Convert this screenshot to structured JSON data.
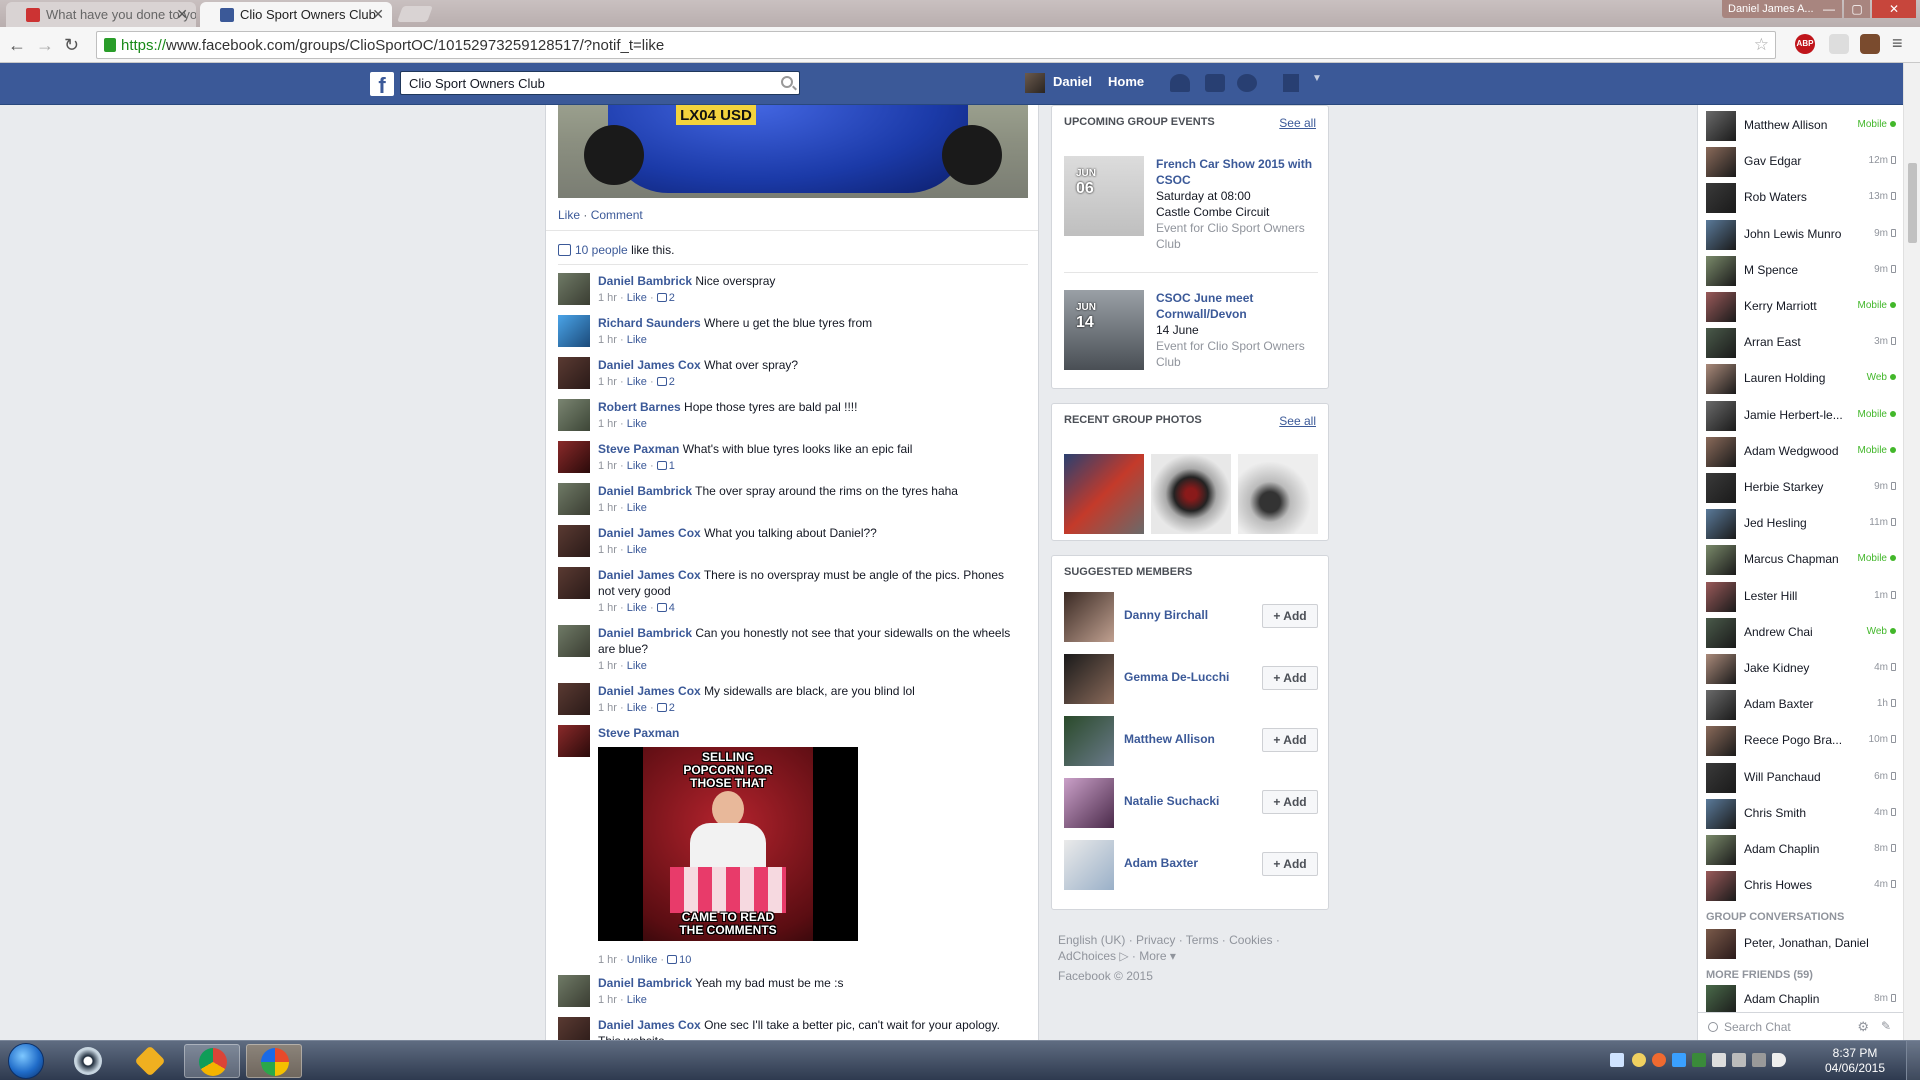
{
  "browser": {
    "tabs": [
      {
        "title": "What have you done to yo"
      },
      {
        "title": "Clio Sport Owners Club"
      }
    ],
    "window_user": "Daniel James A...",
    "url_https": "https://",
    "url_rest": "www.facebook.com/groups/ClioSportOC/10152973259128517/?notif_t=like",
    "extension_badge": "ABP"
  },
  "fb_header": {
    "logo": "f",
    "search_value": "Clio Sport Owners Club",
    "user_name": "Daniel",
    "home_label": "Home"
  },
  "post": {
    "plate": "LX04 USD",
    "like_label": "Like",
    "comment_label": "Comment",
    "likes_people": "10 people",
    "likes_suffix": "like this."
  },
  "comments": [
    {
      "name": "Daniel Bambrick",
      "text": "Nice overspray",
      "time": "1 hr",
      "likes": "2"
    },
    {
      "name": "Richard Saunders",
      "text": "Where u get the blue tyres from",
      "time": "1 hr",
      "likes": ""
    },
    {
      "name": "Daniel James Cox",
      "text": "What over spray?",
      "time": "1 hr",
      "likes": "2"
    },
    {
      "name": "Robert Barnes",
      "text": "Hope those tyres are bald pal !!!!",
      "time": "1 hr",
      "likes": ""
    },
    {
      "name": "Steve Paxman",
      "text": "What's with blue tyres looks like an epic fail",
      "time": "1 hr",
      "likes": "1"
    },
    {
      "name": "Daniel Bambrick",
      "text": "The over spray around the rims on the tyres haha",
      "time": "1 hr",
      "likes": ""
    },
    {
      "name": "Daniel James Cox",
      "text": "What you talking about Daniel??",
      "time": "1 hr",
      "likes": ""
    },
    {
      "name": "Daniel James Cox",
      "text": "There is no overspray must be angle of the pics. Phones not very good",
      "time": "1 hr",
      "likes": "4"
    },
    {
      "name": "Daniel Bambrick",
      "text": "Can you honestly not see that your sidewalls on the wheels are blue?",
      "time": "1 hr",
      "likes": ""
    },
    {
      "name": "Daniel James Cox",
      "text": "My sidewalls are black, are you blind lol",
      "time": "1 hr",
      "likes": "2"
    },
    {
      "name": "Steve Paxman",
      "text": "",
      "time": "1 hr",
      "likes": "10"
    },
    {
      "name": "Daniel Bambrick",
      "text": "Yeah my bad must be me :s",
      "time": "1 hr",
      "likes": ""
    },
    {
      "name": "Daniel James Cox",
      "text": "One sec I'll take a better pic, can't wait for your apology. This website",
      "time": "",
      "likes": ""
    }
  ],
  "comment_meta": {
    "like": "Like",
    "unlike": "Unlike",
    "sep": " · "
  },
  "meme": {
    "top_text": "SELLING POPCORN FOR THOSE THAT",
    "bottom_text": "CAME TO READ THE COMMENTS"
  },
  "events_panel": {
    "title": "UPCOMING GROUP EVENTS",
    "see_all": "See all",
    "events": [
      {
        "month": "JUN",
        "day": "06",
        "title": "French Car Show 2015 with CSOC",
        "when": "Saturday at 08:00",
        "where": "Castle Combe Circuit",
        "sub": "Event for Clio Sport Owners Club"
      },
      {
        "month": "JUN",
        "day": "14",
        "title": "CSOC June meet Cornwall/Devon",
        "when": "14 June",
        "where": "",
        "sub": "Event for Clio Sport Owners Club"
      }
    ]
  },
  "photos_panel": {
    "title": "RECENT GROUP PHOTOS",
    "see_all": "See all"
  },
  "suggested_panel": {
    "title": "SUGGESTED MEMBERS",
    "add_label": "Add",
    "members": [
      {
        "name": "Danny Birchall"
      },
      {
        "name": "Gemma De-Lucchi"
      },
      {
        "name": "Matthew Allison"
      },
      {
        "name": "Natalie Suchacki"
      },
      {
        "name": "Adam Baxter"
      }
    ]
  },
  "footer": {
    "line1": "English (UK) · Privacy · Terms · Cookies ·",
    "line2": "AdChoices ▷ · More ▾",
    "copyright": "Facebook © 2015"
  },
  "chat": {
    "friends": [
      {
        "name": "Matthew Allison",
        "status": "Mobile",
        "kind": "mobile"
      },
      {
        "name": "Gav Edgar",
        "status": "12m",
        "kind": "idle"
      },
      {
        "name": "Rob Waters",
        "status": "13m",
        "kind": "idle"
      },
      {
        "name": "John Lewis Munro",
        "status": "9m",
        "kind": "idle"
      },
      {
        "name": "M Spence",
        "status": "9m",
        "kind": "idle"
      },
      {
        "name": "Kerry Marriott",
        "status": "Mobile",
        "kind": "mobile"
      },
      {
        "name": "Arran East",
        "status": "3m",
        "kind": "idle"
      },
      {
        "name": "Lauren Holding",
        "status": "Web",
        "kind": "web"
      },
      {
        "name": "Jamie Herbert-le...",
        "status": "Mobile",
        "kind": "mobile"
      },
      {
        "name": "Adam Wedgwood",
        "status": "Mobile",
        "kind": "mobile"
      },
      {
        "name": "Herbie Starkey",
        "status": "9m",
        "kind": "idle"
      },
      {
        "name": "Jed Hesling",
        "status": "11m",
        "kind": "idle"
      },
      {
        "name": "Marcus Chapman",
        "status": "Mobile",
        "kind": "mobile"
      },
      {
        "name": "Lester Hill",
        "status": "1m",
        "kind": "idle"
      },
      {
        "name": "Andrew Chai",
        "status": "Web",
        "kind": "web"
      },
      {
        "name": "Jake Kidney",
        "status": "4m",
        "kind": "idle"
      },
      {
        "name": "Adam Baxter",
        "status": "1h",
        "kind": "idle"
      },
      {
        "name": "Reece Pogo Bra...",
        "status": "10m",
        "kind": "idle"
      },
      {
        "name": "Will Panchaud",
        "status": "6m",
        "kind": "idle"
      },
      {
        "name": "Chris Smith",
        "status": "4m",
        "kind": "idle"
      },
      {
        "name": "Adam Chaplin",
        "status": "8m",
        "kind": "idle"
      },
      {
        "name": "Chris Howes",
        "status": "4m",
        "kind": "idle"
      }
    ],
    "group_conv_title": "GROUP CONVERSATIONS",
    "group_conv": "Peter, Jonathan, Daniel",
    "more_friends_title": "MORE FRIENDS (59)",
    "more_friends": [
      {
        "name": "Adam Chaplin",
        "status": "8m"
      }
    ],
    "search_placeholder": "Search Chat"
  },
  "taskbar": {
    "time": "8:37 PM",
    "date": "04/06/2015"
  },
  "colors": {
    "fb_blue": "#3b5998",
    "online_green": "#42b72a",
    "link": "#3b5998"
  }
}
